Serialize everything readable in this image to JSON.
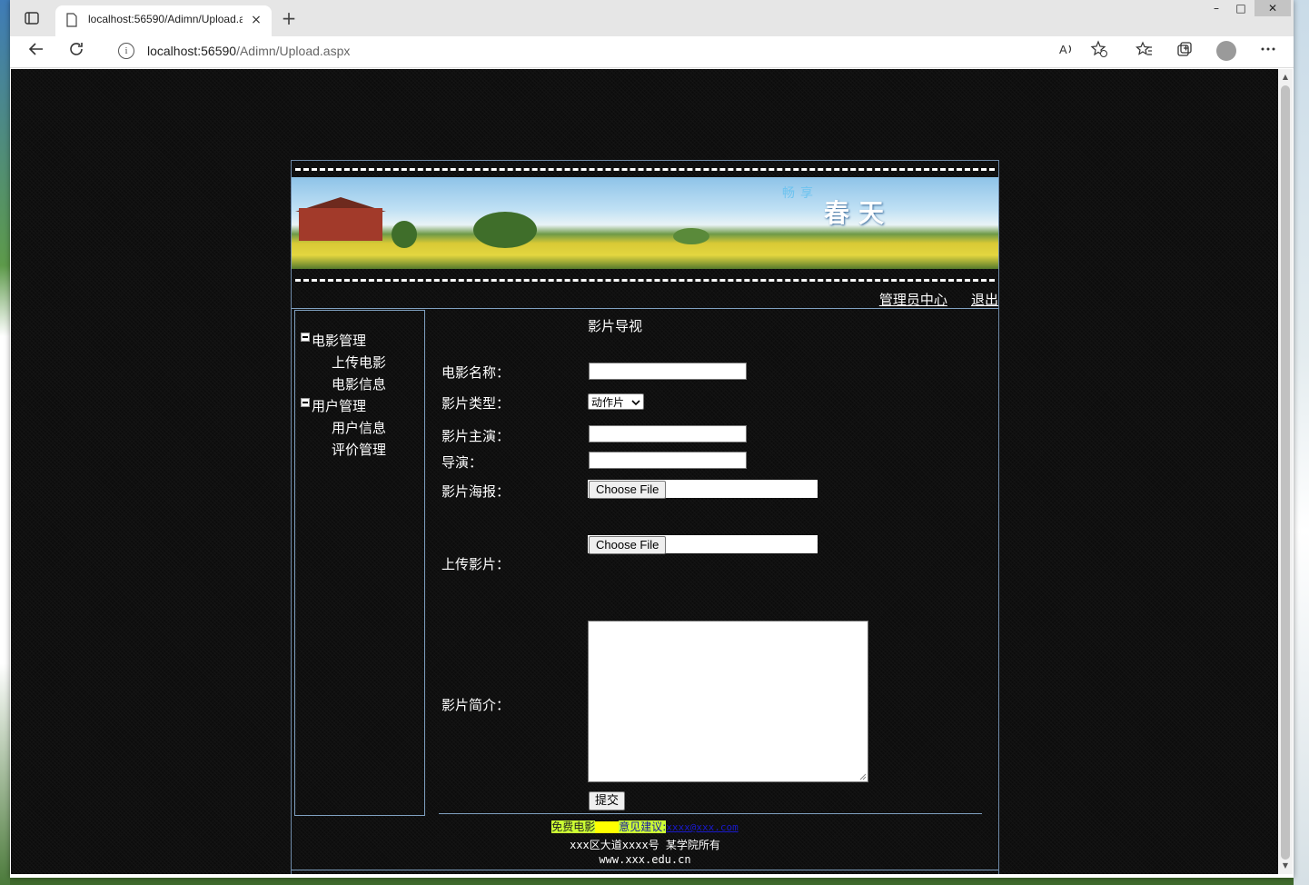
{
  "browser": {
    "tab_title": "localhost:56590/Adimn/Upload.a",
    "new_tab": "+",
    "close_tab": "×",
    "minimize": "–",
    "maximize": "□",
    "close_window": "✕",
    "url_host": "localhost:56590",
    "url_path": "/Adimn/Upload.aspx",
    "info": "i"
  },
  "site": {
    "banner_small": "畅享",
    "banner_big": "春天",
    "nav": {
      "admin_center": "管理员中心",
      "logout": "退出"
    }
  },
  "sidebar": {
    "groups": [
      {
        "label": "电影管理",
        "items": [
          "上传电影",
          "电影信息"
        ]
      },
      {
        "label": "用户管理",
        "items": [
          "用户信息",
          "评价管理"
        ]
      }
    ]
  },
  "form": {
    "title": "影片导视",
    "movie_name_label": "电影名称：",
    "type_label": "影片类型：",
    "type_selected": "动作片",
    "cast_label": "影片主演：",
    "director_label": "导演：",
    "poster_label": "影片海报：",
    "upload_label": "上传影片：",
    "intro_label": "影片简介：",
    "choose_file": "Choose File",
    "submit": "提交"
  },
  "footer": {
    "free_movies": "免费电影",
    "advice": "意见建议:",
    "email": "xxxx@xxx.com",
    "address": "xxx区大道xxxx号 某学院所有",
    "website": "www.xxx.edu.cn"
  }
}
